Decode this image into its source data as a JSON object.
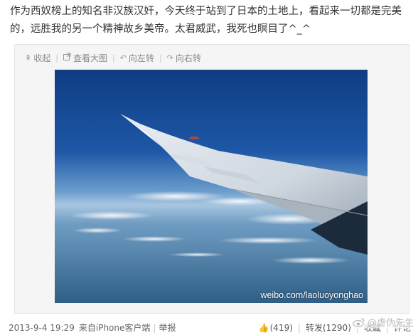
{
  "post": {
    "text": "作为西奴榜上的知名非汉族汉奸，今天终于站到了日本的土地上，看起来一切都是完美的，远胜我的另一个精神故乡美帝。太君威武，我死也瞑目了^_^"
  },
  "toolbar": {
    "collapse": "收起",
    "view_large": "查看大图",
    "rotate_left": "向左转",
    "rotate_right": "向右转"
  },
  "image": {
    "watermark": "weibo.com/laoluoyonghao",
    "sky_color": "#1d4f9a",
    "horizon_color": "#8fb3d6",
    "sea_color": "#3c6f9a"
  },
  "footer": {
    "timestamp": "2013-9-4 19:29",
    "source": "来自iPhone客户端",
    "report": "举报",
    "likes": "(419)",
    "repost_label": "转发",
    "repost_count": "(1290)",
    "favorite_label": "收藏",
    "comment_label": "评论"
  },
  "brand": {
    "label": "@虚伪先生"
  }
}
